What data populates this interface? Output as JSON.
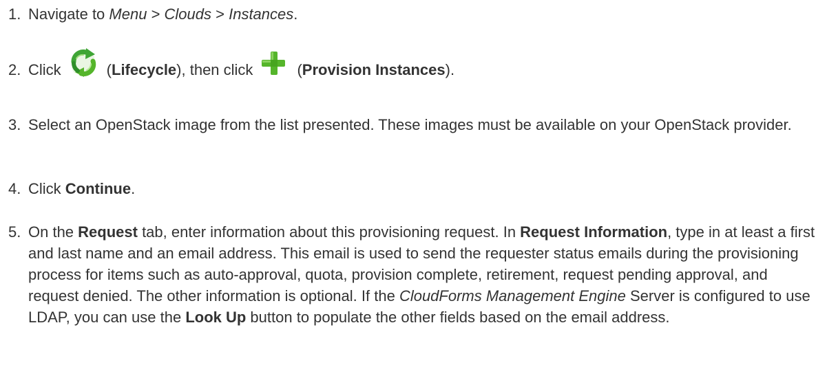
{
  "steps": [
    {
      "number": "1.",
      "navigate_prefix": "Navigate to ",
      "menu": "Menu",
      "sep1": " > ",
      "clouds": "Clouds",
      "sep2": " > ",
      "instances": "Instances",
      "end": "."
    },
    {
      "number": "2.",
      "click_prefix": "Click",
      "lifecycle_open": "(",
      "lifecycle_label": "Lifecycle",
      "lifecycle_close": "), then click",
      "provision_open": "(",
      "provision_label": "Provision Instances",
      "provision_close": ").",
      "lifecycle_icon": "recycle-icon",
      "provision_icon": "plus-icon",
      "lifecycle_icon_color": "#3fa535",
      "provision_icon_color": "#55b52b"
    },
    {
      "number": "3.",
      "text": "Select an OpenStack image from the list presented. These images must be available on your OpenStack provider."
    },
    {
      "number": "4.",
      "click_prefix": "Click ",
      "continue_label": "Continue",
      "end": "."
    },
    {
      "number": "5.",
      "on_the": "On the ",
      "request_tab": "Request",
      "after_tab": " tab, enter information about this provisioning request. In ",
      "request_information": "Request Information",
      "body1": ", type in at least a first and last name and an email address. This email is used to send the requester status emails during the provisioning process for items such as auto-approval, quota, provision complete, retirement, request pending approval, and request denied. The other information is optional. If the ",
      "product_name": "CloudForms Management Engine",
      "body2": " Server is configured to use LDAP, you can use the ",
      "lookup_button": "Look Up",
      "body3": " button to populate the other fields based on the email address."
    }
  ]
}
